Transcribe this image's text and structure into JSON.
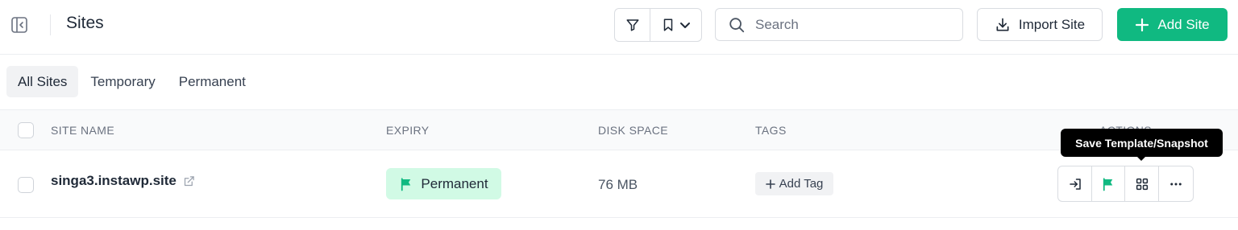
{
  "header": {
    "title": "Sites",
    "search_placeholder": "Search",
    "import_label": "Import Site",
    "add_label": "Add Site"
  },
  "tabs": [
    {
      "label": "All Sites",
      "active": true
    },
    {
      "label": "Temporary",
      "active": false
    },
    {
      "label": "Permanent",
      "active": false
    }
  ],
  "table": {
    "columns": {
      "site_name": "SITE NAME",
      "expiry": "EXPIRY",
      "disk_space": "DISK SPACE",
      "tags": "TAGS",
      "actions": "ACTIONS"
    },
    "rows": [
      {
        "site_name": "singa3.instawp.site",
        "expiry": "Permanent",
        "disk_space": "76 MB",
        "add_tag_label": "Add Tag"
      }
    ]
  },
  "tooltip": "Save Template/Snapshot",
  "icons": {
    "collapse": "sidebar-collapse-icon",
    "filter": "filter-icon",
    "bookmark": "bookmark-icon",
    "chevron": "chevron-down-icon",
    "search": "search-icon",
    "download": "download-icon",
    "plus": "plus-icon",
    "external": "external-link-icon",
    "flag": "flag-icon",
    "login": "login-icon",
    "grid": "grid-icon",
    "more": "more-icon"
  },
  "colors": {
    "accent": "#10b981",
    "badge_bg": "#d1fae5",
    "flag": "#10b981"
  }
}
